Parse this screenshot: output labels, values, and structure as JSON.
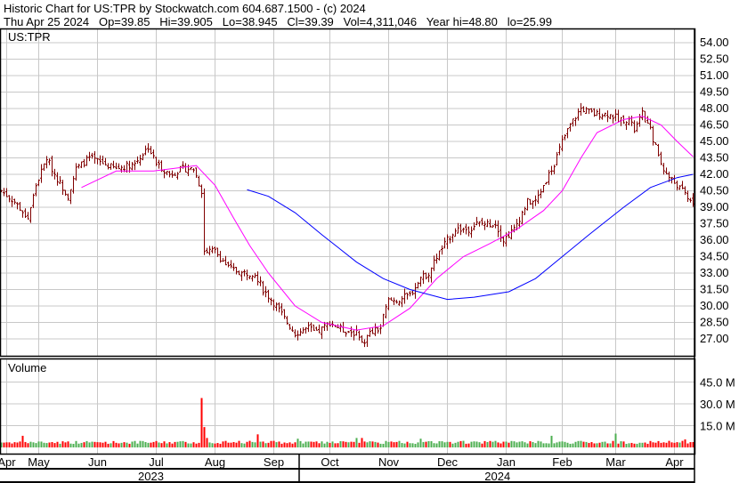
{
  "header": {
    "title": "Historic Chart for US:TPR by Stockwatch.com 604.687.1500 - (c) 2024",
    "quote": "Thu Apr 25 2024   Op=39.85   Hi=39.905   Lo=38.945   Cl=39.39   Vol=4,311,046   Year hi=48.80   lo=25.99"
  },
  "chart_data": {
    "type": "ohlc",
    "symbol_label": "US:TPR",
    "volume_label": "Volume",
    "days": 260,
    "price_axis": {
      "min": 25.5,
      "max": 54.75,
      "ticks": [
        "54.00",
        "52.50",
        "51.00",
        "49.50",
        "48.00",
        "46.50",
        "45.00",
        "43.50",
        "42.00",
        "40.50",
        "39.00",
        "37.50",
        "36.00",
        "34.50",
        "33.00",
        "31.50",
        "30.00",
        "28.50",
        "27.00"
      ]
    },
    "volume_axis": {
      "max": 60,
      "ticks": [
        "45.0 M",
        "30.0 M",
        "15.0 M"
      ]
    },
    "months": [
      {
        "label": "Apr",
        "day": 2
      },
      {
        "label": "May",
        "day": 14
      },
      {
        "label": "Jun",
        "day": 36
      },
      {
        "label": "Jul",
        "day": 58
      },
      {
        "label": "Aug",
        "day": 80
      },
      {
        "label": "Sep",
        "day": 102
      },
      {
        "label": "Oct",
        "day": 123
      },
      {
        "label": "Nov",
        "day": 145
      },
      {
        "label": "Dec",
        "day": 167
      },
      {
        "label": "Jan",
        "day": 189
      },
      {
        "label": "Feb",
        "day": 210
      },
      {
        "label": "Mar",
        "day": 230
      },
      {
        "label": "Apr",
        "day": 252
      }
    ],
    "years": [
      {
        "label": "2023",
        "from": 0,
        "to": 112
      },
      {
        "label": "2024",
        "from": 112,
        "to": 260
      }
    ],
    "close_keypoints": [
      [
        0,
        40.5
      ],
      [
        5,
        39.5
      ],
      [
        10,
        38
      ],
      [
        13,
        41
      ],
      [
        17,
        43.5
      ],
      [
        20,
        42
      ],
      [
        25,
        40
      ],
      [
        28,
        42.5
      ],
      [
        33,
        43.5
      ],
      [
        38,
        43
      ],
      [
        43,
        42.5
      ],
      [
        50,
        43
      ],
      [
        55,
        44.5
      ],
      [
        58,
        43
      ],
      [
        63,
        42
      ],
      [
        68,
        42.5
      ],
      [
        72,
        42.5
      ],
      [
        75,
        40.5
      ],
      [
        76,
        35
      ],
      [
        80,
        35
      ],
      [
        85,
        33.5
      ],
      [
        90,
        33
      ],
      [
        95,
        33
      ],
      [
        98,
        31.5
      ],
      [
        103,
        30
      ],
      [
        107,
        28.5
      ],
      [
        110,
        27.5
      ],
      [
        115,
        28
      ],
      [
        118,
        27.5
      ],
      [
        123,
        28.5
      ],
      [
        128,
        27.8
      ],
      [
        133,
        27.5
      ],
      [
        135,
        26.5
      ],
      [
        138,
        27.5
      ],
      [
        142,
        28
      ],
      [
        143,
        29
      ],
      [
        145,
        30.5
      ],
      [
        148,
        30.5
      ],
      [
        153,
        31
      ],
      [
        157,
        32.5
      ],
      [
        160,
        33
      ],
      [
        163,
        34.5
      ],
      [
        167,
        36
      ],
      [
        170,
        37
      ],
      [
        175,
        37
      ],
      [
        178,
        37.5
      ],
      [
        182,
        37.5
      ],
      [
        185,
        37.5
      ],
      [
        188,
        36
      ],
      [
        192,
        37
      ],
      [
        197,
        39.5
      ],
      [
        200,
        39.5
      ],
      [
        203,
        41
      ],
      [
        207,
        43
      ],
      [
        210,
        45
      ],
      [
        213,
        46.5
      ],
      [
        217,
        48
      ],
      [
        222,
        47.5
      ],
      [
        227,
        47.5
      ],
      [
        232,
        47
      ],
      [
        235,
        47
      ],
      [
        237,
        46
      ],
      [
        240,
        47.5
      ],
      [
        243,
        46
      ],
      [
        247,
        43
      ],
      [
        249,
        42
      ],
      [
        253,
        41
      ],
      [
        257,
        40
      ],
      [
        259,
        39.4
      ]
    ],
    "ma50": [
      [
        30,
        40.8
      ],
      [
        43,
        42.3
      ],
      [
        57,
        42.3
      ],
      [
        73,
        42.8
      ],
      [
        80,
        41
      ],
      [
        87,
        38
      ],
      [
        93,
        35.5
      ],
      [
        100,
        33
      ],
      [
        110,
        30
      ],
      [
        120,
        28.5
      ],
      [
        133,
        27.8
      ],
      [
        143,
        28.2
      ],
      [
        153,
        29.8
      ],
      [
        163,
        32.5
      ],
      [
        173,
        34.5
      ],
      [
        183,
        35.7
      ],
      [
        193,
        37
      ],
      [
        203,
        38.7
      ],
      [
        210,
        40.5
      ],
      [
        217,
        43.5
      ],
      [
        223,
        45.8
      ],
      [
        233,
        47
      ],
      [
        240,
        47.3
      ],
      [
        247,
        46.5
      ],
      [
        253,
        45
      ],
      [
        259,
        43.6
      ]
    ],
    "ma200": [
      [
        92,
        40.6
      ],
      [
        100,
        40
      ],
      [
        110,
        38.5
      ],
      [
        120,
        36.5
      ],
      [
        133,
        34
      ],
      [
        143,
        32.5
      ],
      [
        153,
        31.5
      ],
      [
        167,
        30.6
      ],
      [
        177,
        30.8
      ],
      [
        190,
        31.3
      ],
      [
        200,
        32.5
      ],
      [
        210,
        34.5
      ],
      [
        220,
        36.5
      ],
      [
        233,
        39
      ],
      [
        243,
        40.8
      ],
      [
        253,
        41.7
      ],
      [
        259,
        42
      ]
    ],
    "volume_base_m": 3.5,
    "volume_spikes_m": [
      [
        8,
        8
      ],
      [
        75,
        34
      ],
      [
        76,
        14
      ],
      [
        77,
        6.5
      ],
      [
        96,
        9
      ],
      [
        111,
        6
      ],
      [
        133,
        6.5
      ],
      [
        135,
        6.5
      ],
      [
        157,
        6
      ],
      [
        206,
        8
      ],
      [
        230,
        9.5
      ],
      [
        256,
        5.5
      ]
    ],
    "colors": {
      "bar": "#800000",
      "up": "#4caf50",
      "down": "#ff0000",
      "ma50": "#ff00ff",
      "ma200": "#0000ff",
      "grid": "#c8c8c8"
    }
  }
}
